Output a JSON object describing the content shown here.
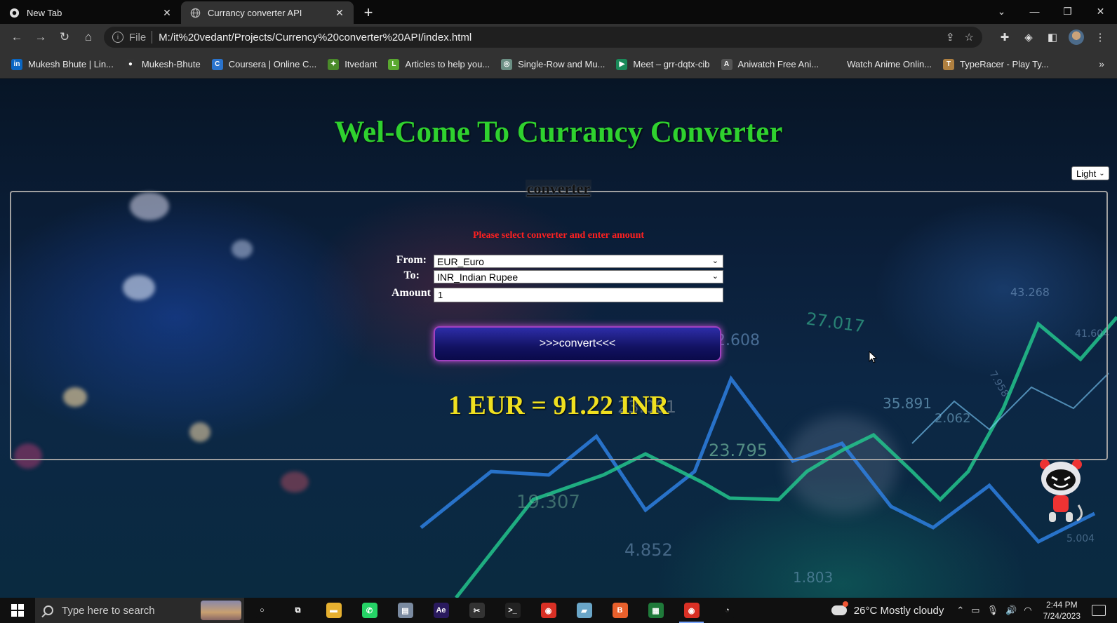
{
  "browser": {
    "tabs": [
      {
        "title": "New Tab",
        "active": false
      },
      {
        "title": "Currancy converter API",
        "active": true
      }
    ],
    "address": {
      "protocol": "File",
      "url": "M:/it%20vedant/Projects/Currency%20converter%20API/index.html"
    },
    "bookmarks": [
      {
        "label": "Mukesh Bhute | Lin...",
        "icon": "linkedin-icon",
        "color": "#0a66c2",
        "glyph": "in"
      },
      {
        "label": "Mukesh-Bhute",
        "icon": "github-icon",
        "color": "#333333",
        "glyph": "●"
      },
      {
        "label": "Coursera | Online C...",
        "icon": "coursera-icon",
        "color": "#2a73cc",
        "glyph": "C"
      },
      {
        "label": "Itvedant",
        "icon": "itvedant-icon",
        "color": "#4a8a2a",
        "glyph": "✦"
      },
      {
        "label": "Articles to help you...",
        "icon": "articles-icon",
        "color": "#5aa830",
        "glyph": "L"
      },
      {
        "label": "Single-Row and Mu...",
        "icon": "openai-icon",
        "color": "#6b8f84",
        "glyph": "◎"
      },
      {
        "label": "Meet – grr-dqtx-cib",
        "icon": "meet-icon",
        "color": "#1a8a5a",
        "glyph": "▶"
      },
      {
        "label": "Aniwatch Free Ani...",
        "icon": "aniwatch-icon",
        "color": "#555555",
        "glyph": "A"
      },
      {
        "label": "Watch Anime Onlin...",
        "icon": "anime-icon",
        "color": "#323232",
        "glyph": ""
      },
      {
        "label": "TypeRacer - Play Ty...",
        "icon": "typeracer-icon",
        "color": "#b08040",
        "glyph": "T"
      }
    ]
  },
  "page": {
    "heading": "Wel-Come To Currancy Converter",
    "theme_option": "Light",
    "legend": "converter",
    "message": "Please select converter and enter amount",
    "from_label": "From:",
    "from_value": "EUR_Euro",
    "to_label": "To:",
    "to_value": "INR_Indian Rupee",
    "amount_label": "Amount",
    "amount_value": "1",
    "convert_label": ">>>convert<<<",
    "result": "1 EUR = 91.22 INR"
  },
  "taskbar": {
    "search_placeholder": "Type here to search",
    "weather": "26°C  Mostly cloudy",
    "time": "2:44 PM",
    "date": "7/24/2023",
    "apps": [
      {
        "name": "cortana-icon",
        "color": "#101010",
        "glyph": "○",
        "active": false
      },
      {
        "name": "task-view-icon",
        "color": "#101010",
        "glyph": "⧉",
        "active": false
      },
      {
        "name": "file-explorer-icon",
        "color": "#e6b030",
        "glyph": "▬",
        "active": false
      },
      {
        "name": "whatsapp-icon",
        "color": "#25d366",
        "glyph": "✆",
        "active": false
      },
      {
        "name": "app-icon",
        "color": "#7a8aa0",
        "glyph": "▤",
        "active": false
      },
      {
        "name": "after-effects-icon",
        "color": "#2a1a5e",
        "glyph": "Ae",
        "active": false
      },
      {
        "name": "clapper-icon",
        "color": "#333333",
        "glyph": "✂",
        "active": false
      },
      {
        "name": "terminal-icon",
        "color": "#222222",
        "glyph": ">_",
        "active": false
      },
      {
        "name": "chrome-icon",
        "color": "#d93025",
        "glyph": "◉",
        "active": false
      },
      {
        "name": "notes-icon",
        "color": "#6aa6c8",
        "glyph": "▰",
        "active": false
      },
      {
        "name": "bandicam-icon",
        "color": "#e8602c",
        "glyph": "B",
        "active": false
      },
      {
        "name": "sheets-icon",
        "color": "#1f7a3a",
        "glyph": "▦",
        "active": false
      },
      {
        "name": "chrome-profile-icon",
        "color": "#d93025",
        "glyph": "◉",
        "active": true
      },
      {
        "name": "record-icon",
        "color": "#101010",
        "glyph": "◔",
        "active": false
      }
    ]
  }
}
